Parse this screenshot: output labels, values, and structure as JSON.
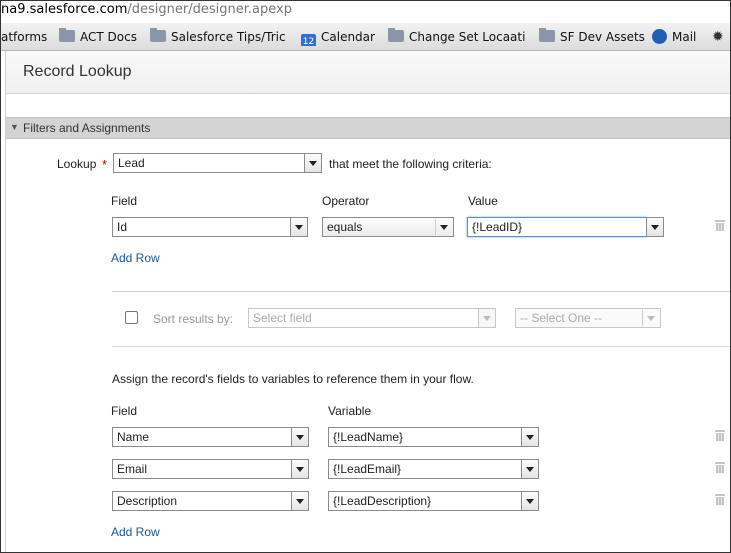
{
  "browser": {
    "url_host": "na9.salesforce.com",
    "url_path": "/designer/designer.apexp",
    "bookmarks": [
      {
        "label": "atforms",
        "icon": "none"
      },
      {
        "label": "ACT Docs",
        "icon": "folder-icon"
      },
      {
        "label": "Salesforce Tips/Trick",
        "icon": "folder-icon"
      },
      {
        "label": "Calendar",
        "icon": "calendar-icon",
        "icon_text": "12"
      },
      {
        "label": "Change Set Locaation",
        "icon": "folder-icon"
      },
      {
        "label": "SF Dev Assets",
        "icon": "folder-icon"
      },
      {
        "label": "Mail",
        "icon": "mail-icon"
      },
      {
        "label": "",
        "icon": "loading-spinner-icon"
      }
    ]
  },
  "dialog": {
    "title": "Record Lookup",
    "section_title": "Filters and Assignments",
    "lookup": {
      "label": "Lookup",
      "required_mark": "*",
      "object_value": "Lead",
      "criteria_text": "that meet the following criteria:"
    },
    "filter_headers": {
      "field": "Field",
      "operator": "Operator",
      "value": "Value"
    },
    "filters": [
      {
        "field": "Id",
        "operator": "equals",
        "value": "{!LeadID}"
      }
    ],
    "add_row_label": "Add Row",
    "sort": {
      "checked": false,
      "label": "Sort results by:",
      "field_placeholder": "Select field",
      "order_placeholder": "-- Select One --"
    },
    "assign_intro": "Assign the record's fields to variables to reference them in your flow.",
    "assign_headers": {
      "field": "Field",
      "variable": "Variable"
    },
    "assignments": [
      {
        "field": "Name",
        "variable": "{!LeadName}"
      },
      {
        "field": "Email",
        "variable": "{!LeadEmail}"
      },
      {
        "field": "Description",
        "variable": "{!LeadDescription}"
      }
    ],
    "add_row_label_2": "Add Row"
  },
  "colors": {
    "link": "#1a57a6",
    "required": "#cc0000",
    "section_bar": "#d4d4d4"
  }
}
